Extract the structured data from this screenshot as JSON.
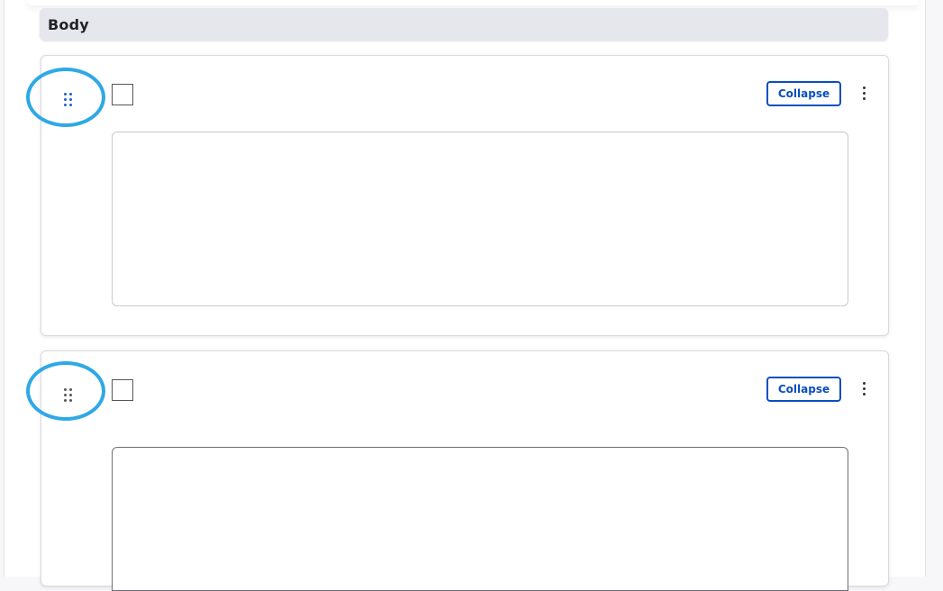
{
  "section": {
    "title": "Body"
  },
  "paragraphs": [
    {
      "collapse_label": "Collapse",
      "drag_handle_color": "#1f5fc9",
      "highlight_color": "#2fa8e6"
    },
    {
      "collapse_label": "Collapse",
      "drag_handle_color": "#55555c",
      "highlight_color": "#2fa8e6"
    }
  ],
  "colors": {
    "accent": "#0a4fbf",
    "section_header_bg": "#e6e7ec"
  },
  "icons": {
    "drag_handle": "drag-handle-icon",
    "more": "kebab-menu-icon"
  }
}
